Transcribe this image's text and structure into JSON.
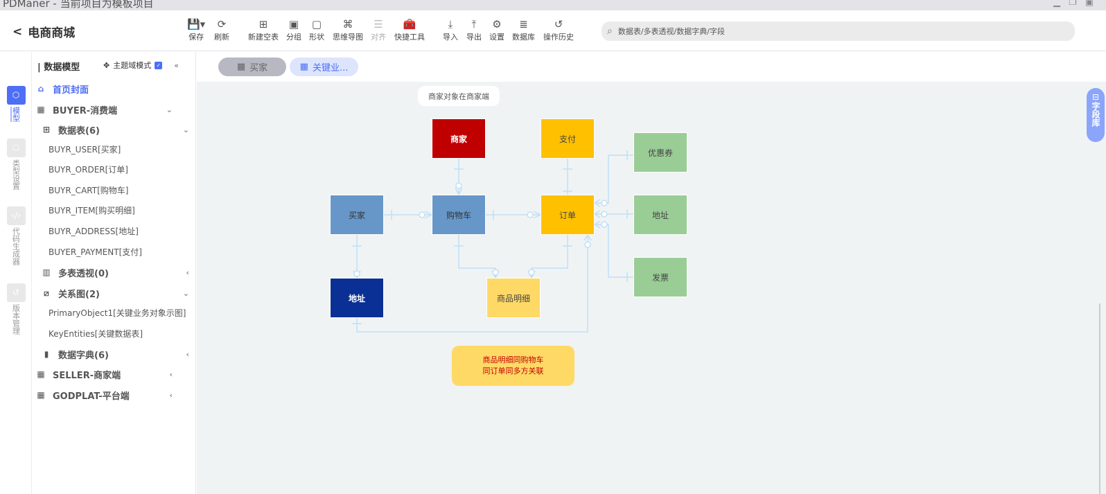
{
  "window": {
    "title": "PDManer - 当前项目为模板项目"
  },
  "header": {
    "project": "电商商城",
    "search_placeholder": "数据表/多表透视/数据字典/字段",
    "tools": [
      "保存",
      "刷新",
      "新建空表",
      "分组",
      "形状",
      "思维导图",
      "对齐",
      "快捷工具",
      "导入",
      "导出",
      "设置",
      "数据库",
      "操作历史"
    ]
  },
  "rail": [
    "模型",
    "类型设置",
    "代码生成器",
    "版本管理"
  ],
  "sidebar": {
    "title": "数据模型",
    "mode_label": "主题域模式",
    "mode_checked": true,
    "home": "首页封面",
    "buyer": "BUYER-消费端",
    "tables": "数据表(6)",
    "table_items": [
      "BUYR_USER[买家]",
      "BUYR_ORDER[订单]",
      "BUYR_CART[购物车]",
      "BUYR_ITEM[购买明细]",
      "BUYR_ADDRESS[地址]",
      "BUYER_PAYMENT[支付]"
    ],
    "views": "多表透视(0)",
    "diagrams": "关系图(2)",
    "diagram_items": [
      "PrimaryObject1[关键业务对象示图]",
      "KeyEntities[关键数据表]"
    ],
    "dicts": "数据字典(6)",
    "seller": "SELLER-商家端",
    "godplat": "GODPLAT-平台端"
  },
  "tabs": [
    "买家",
    "关键业..."
  ],
  "canvas": {
    "note_top": "商家对象在商家端",
    "note_bottom_1": "商品明细同购物车",
    "note_bottom_2": "同订单同多方关联",
    "entities": {
      "merchant": "商家",
      "payment": "支付",
      "buyer": "买家",
      "cart": "购物车",
      "order": "订单",
      "coupon": "优惠券",
      "address_green": "地址",
      "invoice": "发票",
      "address_blue": "地址",
      "item": "商品明细"
    },
    "colors": {
      "red": "#c00000",
      "yellow": "#ffc000",
      "blue": "#6797c8",
      "navy": "#0a3096",
      "lightyellow": "#ffd966",
      "green": "#9acd95",
      "line": "#bfe0f7"
    },
    "field_lib": "字段库"
  }
}
